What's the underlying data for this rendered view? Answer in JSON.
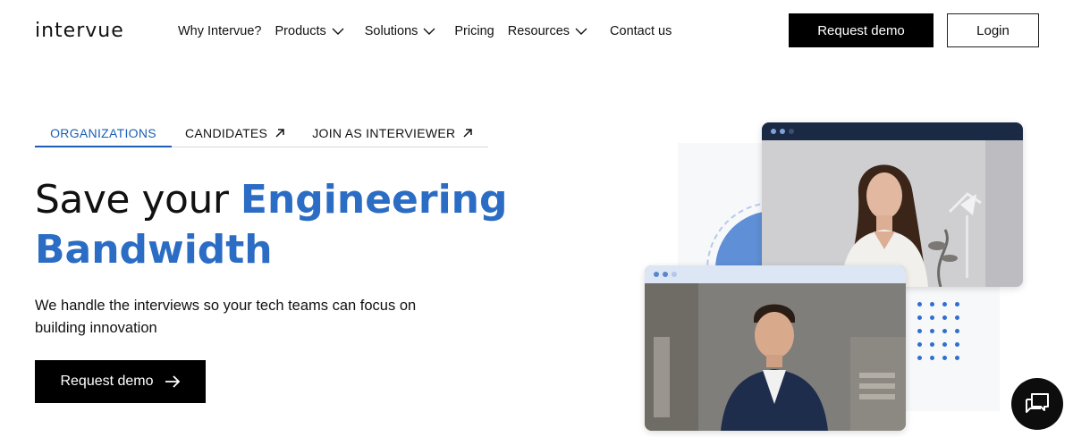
{
  "brand": {
    "logo_text": "intervue"
  },
  "nav": {
    "items": [
      {
        "label": "Why Intervue?",
        "has_dropdown": false
      },
      {
        "label": "Products",
        "has_dropdown": true
      },
      {
        "label": "Solutions",
        "has_dropdown": true
      },
      {
        "label": "Pricing",
        "has_dropdown": false
      },
      {
        "label": "Resources",
        "has_dropdown": true
      },
      {
        "label": "Contact us",
        "has_dropdown": false
      }
    ],
    "request_demo_label": "Request demo",
    "login_label": "Login"
  },
  "tabs": [
    {
      "label": "ORGANIZATIONS",
      "active": true,
      "external": false
    },
    {
      "label": "CANDIDATES",
      "active": false,
      "external": true
    },
    {
      "label": "JOIN AS INTERVIEWER",
      "active": false,
      "external": true
    }
  ],
  "hero": {
    "title_plain": "Save your ",
    "title_highlight_1": "Engineering",
    "title_highlight_2": "Bandwidth",
    "subtitle": "We handle the interviews so your tech teams can focus on building innovation",
    "cta_label": "Request demo"
  },
  "colors": {
    "accent_blue": "#2b6cc4",
    "tab_active": "#1a5fb4",
    "button_black": "#000000"
  },
  "icons": {
    "dropdown": "chevron-down-icon",
    "external": "arrow-up-right-icon",
    "cta": "arrow-right-icon",
    "chat": "chat-bubbles-icon"
  }
}
